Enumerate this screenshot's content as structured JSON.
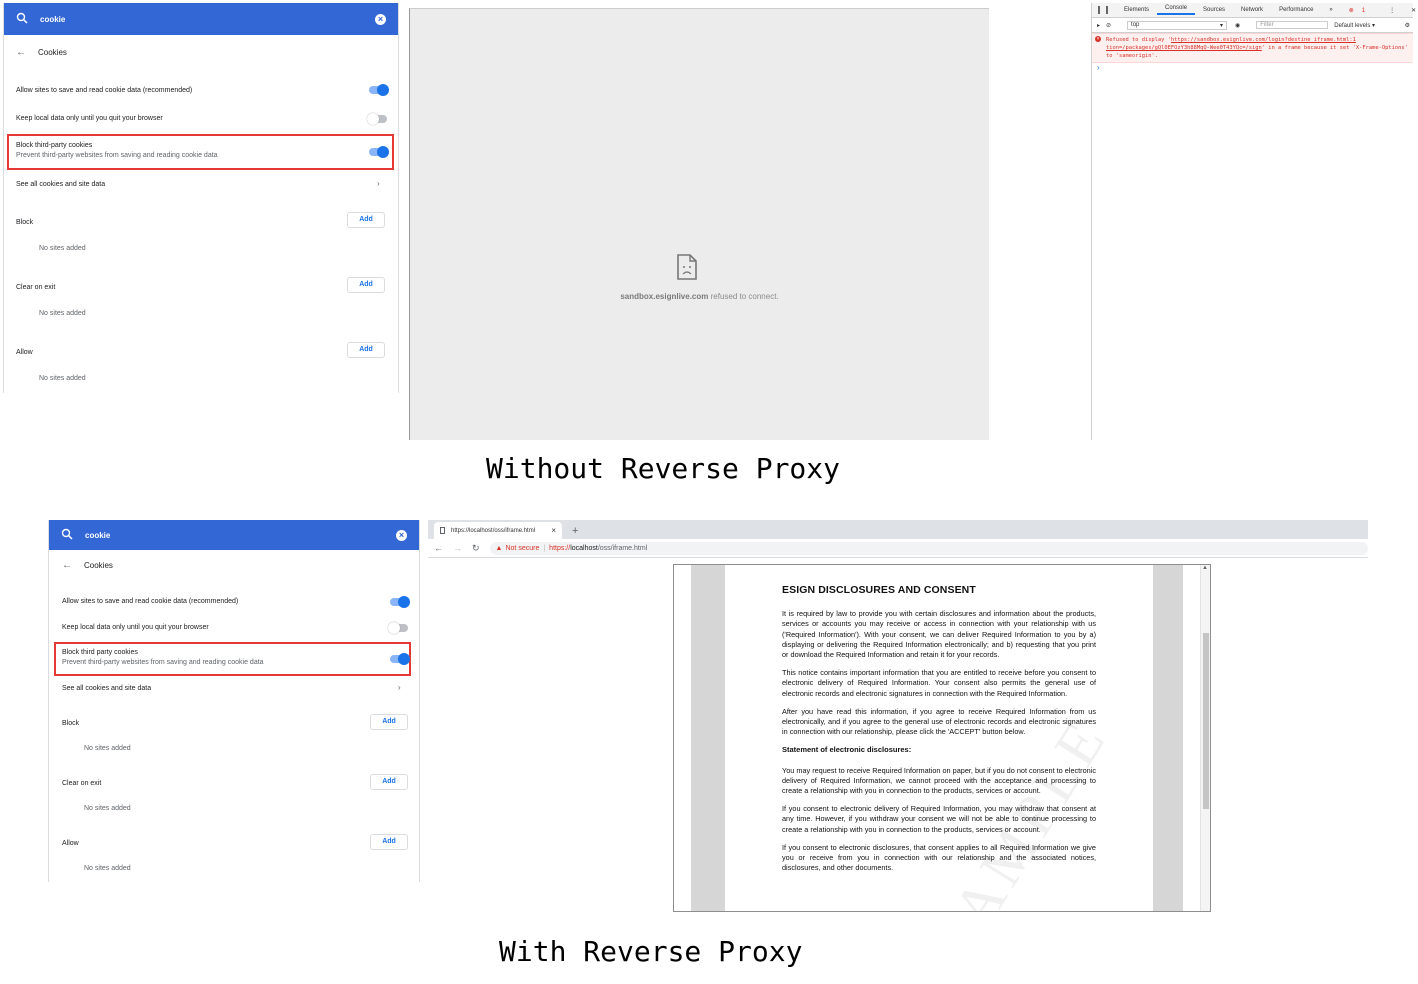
{
  "settings_top": {
    "search_query": "cookie",
    "title": "Cookies",
    "allow_label": "Allow sites to save and read cookie data (recommended)",
    "allow_on": true,
    "keep_label": "Keep local data only until you quit your browser",
    "keep_on": false,
    "block3p_label": "Block third-party cookies",
    "block3p_sub": "Prevent third-party websites from saving and reading cookie data",
    "block3p_on": true,
    "see_all_label": "See all cookies and site data",
    "block_label": "Block",
    "clear_label": "Clear on exit",
    "allow_section_label": "Allow",
    "add_label": "Add",
    "no_sites": "No sites added"
  },
  "settings_bottom": {
    "search_query": "cookie",
    "title": "Cookies",
    "allow_label": "Allow sites to save and read cookie data (recommended)",
    "keep_label": "Keep local data only until you quit your browser",
    "block3p_label": "Block third party cookies",
    "block3p_sub": "Prevent third-party websites from saving and reading cookie data",
    "see_all_label": "See all cookies and site data",
    "block_label": "Block",
    "clear_label": "Clear on exit",
    "allow_section_label": "Allow",
    "add_label": "Add",
    "no_sites": "No sites added"
  },
  "error_frame": {
    "host": "sandbox.esignlive.com",
    "message": "refused to connect."
  },
  "devtools": {
    "tabs": [
      "Elements",
      "Console",
      "Sources",
      "Network",
      "Performance"
    ],
    "more": "»",
    "error_count": "1",
    "context": "top",
    "filter_placeholder": "Filter",
    "levels": "Default levels ▾",
    "error_prefix": "Refused to display '",
    "error_url": "https://sandbox.esignlive.com/login?destine iframe.html:1 tion=/packages/gQl0EFOzY3h88MqQ-Wee0T43YQc=/sign",
    "error_suffix": "' in a frame because it set 'X-Frame-Options' to 'sameorigin'.",
    "prompt": "›"
  },
  "captions": {
    "top": "Without Reverse Proxy",
    "bottom": "With Reverse Proxy"
  },
  "browser": {
    "tab_title": "https://localhost/oss/iframe.html",
    "not_secure": "Not secure",
    "url_scheme": "https://",
    "url_host": "localhost",
    "url_path": "/oss/iframe.html"
  },
  "pdf": {
    "title": "ESIGN DISCLOSURES AND CONSENT",
    "p1": "It is required by law to provide you with certain disclosures and information about the products, services or accounts you may receive or access in connection with your relationship with us ('Required Information'). With your consent, we can deliver Required Information to you by a) displaying or delivering the Required Information electronically; and b) requesting that you print or download the Required Information and retain it for your records.",
    "p2": "This notice contains important information that you are entitled to receive before you consent to electronic delivery of Required Information. Your consent also permits the general use of electronic records and electronic signatures in connection with the Required Information.",
    "p3": "After you have read this information, if you agree to receive Required Information from us electronically, and if you agree to the general use of electronic records and electronic signatures in connection with our relationship, please click the 'ACCEPT' button below.",
    "h2": "Statement of electronic disclosures:",
    "p4": "You may request to receive Required Information on paper, but if you do not consent to electronic delivery of Required Information, we cannot proceed with the acceptance and processing to create a relationship with you in connection to the products, services or account.",
    "p5": "If you consent to electronic delivery of Required Information, you may withdraw that consent at any time. However, if you withdraw your consent we will not be able to continue processing to create a relationship with you in connection to the products, services or account.",
    "p6": "If you consent to electronic disclosures, that consent applies to all Required Information we give you or receive from you in connection with our relationship and the associated notices, disclosures, and other documents."
  }
}
